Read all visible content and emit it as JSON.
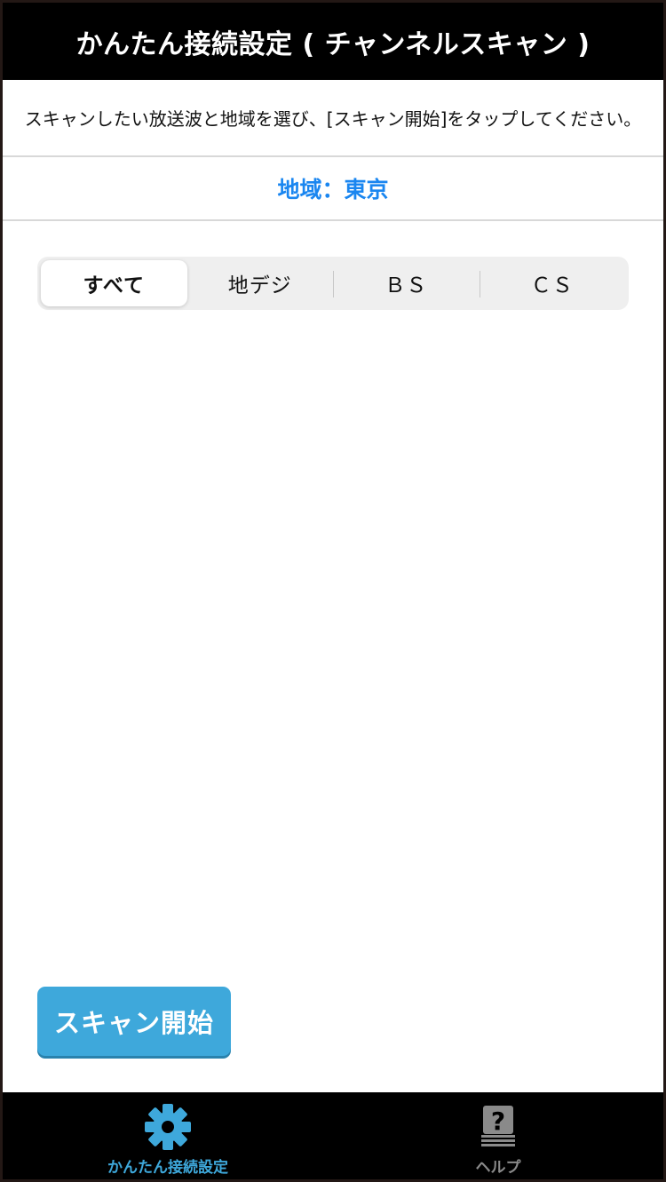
{
  "header": {
    "title": "かんたん接続設定 ( チャンネルスキャン )"
  },
  "instruction": {
    "text": "スキャンしたい放送波と地域を選び、[スキャン開始]をタップしてください。"
  },
  "region": {
    "label": "地域：東京"
  },
  "broadcast_tabs": {
    "selected": "すべて",
    "items": [
      {
        "label": "すべて"
      },
      {
        "label": "地デジ"
      },
      {
        "label": "ＢＳ"
      },
      {
        "label": "ＣＳ"
      }
    ]
  },
  "actions": {
    "scan_button_label": "スキャン開始"
  },
  "tabbar": {
    "items": [
      {
        "label": "かんたん接続設定",
        "icon": "gear-icon"
      },
      {
        "label": "ヘルプ",
        "icon": "help-book-icon"
      }
    ]
  },
  "colors": {
    "accent_blue": "#1a86f0",
    "button_blue": "#3ea8db",
    "tab_active": "#3ea8db",
    "tab_inactive": "#8a8a8a",
    "bar_black": "#000000"
  }
}
